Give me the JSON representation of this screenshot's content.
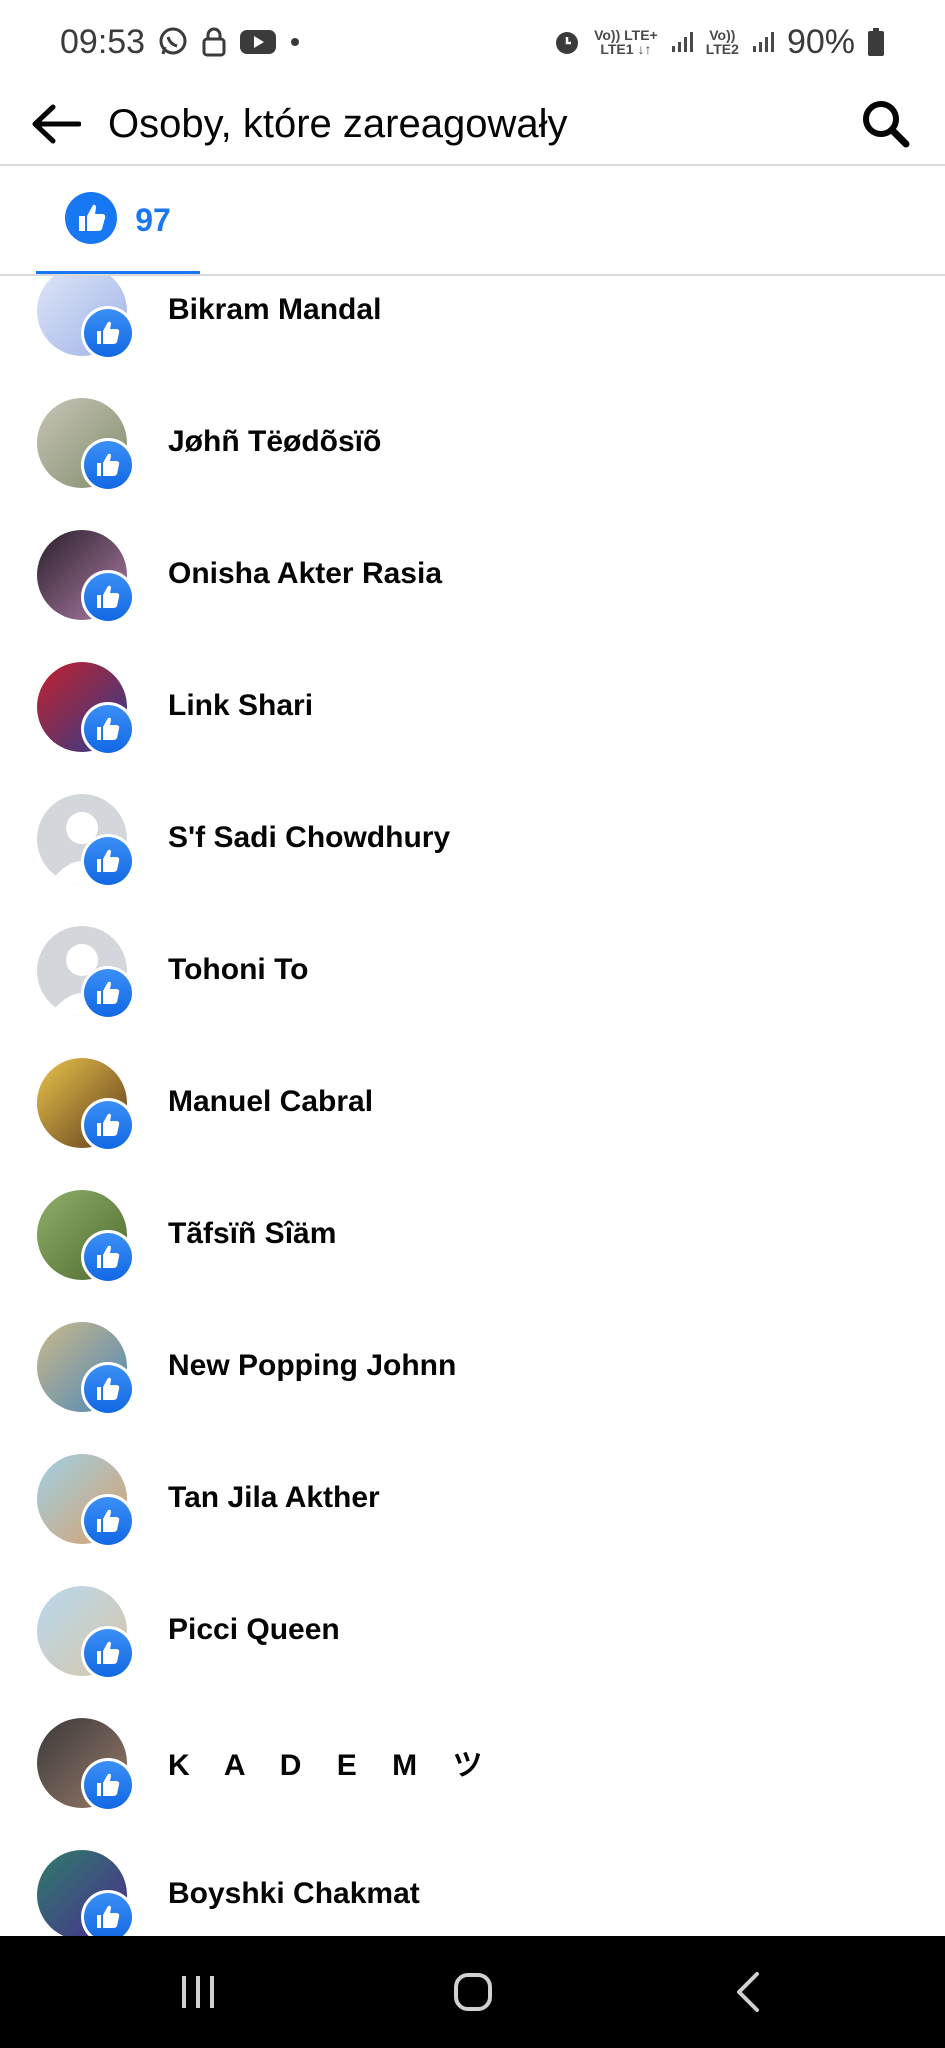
{
  "status": {
    "time": "09:53",
    "lte1": "Vo)) LTE+\nLTE1 ↓↑",
    "lte2": "Vo))\nLTE2",
    "battery": "90%"
  },
  "header": {
    "title": "Osoby, które zareagowały"
  },
  "tab": {
    "count": "97"
  },
  "people": [
    {
      "name": "Bikram Mandal",
      "avatar": [
        "#dfe6f7",
        "#9fb3e8"
      ]
    },
    {
      "name": "Jøhñ Tëødõsïõ",
      "avatar": [
        "#c9c4b7",
        "#7f8d6b"
      ]
    },
    {
      "name": "Onisha Akter Rasia",
      "avatar": [
        "#2a1f2b",
        "#b07fa8"
      ]
    },
    {
      "name": "Link Shari",
      "avatar": [
        "#c3202b",
        "#2a3f8f"
      ]
    },
    {
      "name": "S'f Sadi Chowdhury",
      "avatar": [
        "#d3d6db",
        "#d3d6db"
      ]
    },
    {
      "name": "Tohoni To",
      "avatar": [
        "#d3d6db",
        "#d3d6db"
      ]
    },
    {
      "name": "Manuel Cabral",
      "avatar": [
        "#e8c44a",
        "#5f3a1e"
      ]
    },
    {
      "name": "Tãfsïñ Sîäm",
      "avatar": [
        "#8fae6a",
        "#4f6b2f"
      ]
    },
    {
      "name": "New Popping Johnn",
      "avatar": [
        "#cdb98a",
        "#4a87b8"
      ]
    },
    {
      "name": "Tan Jila Akther",
      "avatar": [
        "#9fd0e6",
        "#d9a06a"
      ]
    },
    {
      "name": "Picci Queen",
      "avatar": [
        "#b8d8ef",
        "#d9c7a8"
      ]
    },
    {
      "name": "K A D E M ツ",
      "avatar": [
        "#3a3a3a",
        "#9a7a6a"
      ]
    },
    {
      "name": "Boyshki Chakmat",
      "avatar": [
        "#2f7d6b",
        "#4b2a8f"
      ]
    }
  ],
  "colors": {
    "accent": "#1877f2",
    "divider": "#d8dadf",
    "navbar": "#000000"
  },
  "icons": {
    "back": "arrow-left-icon",
    "search": "search-icon",
    "like": "thumbs-up-icon",
    "nav_recent": "recent-apps-icon",
    "nav_home": "home-icon",
    "nav_back": "chevron-left-icon"
  }
}
